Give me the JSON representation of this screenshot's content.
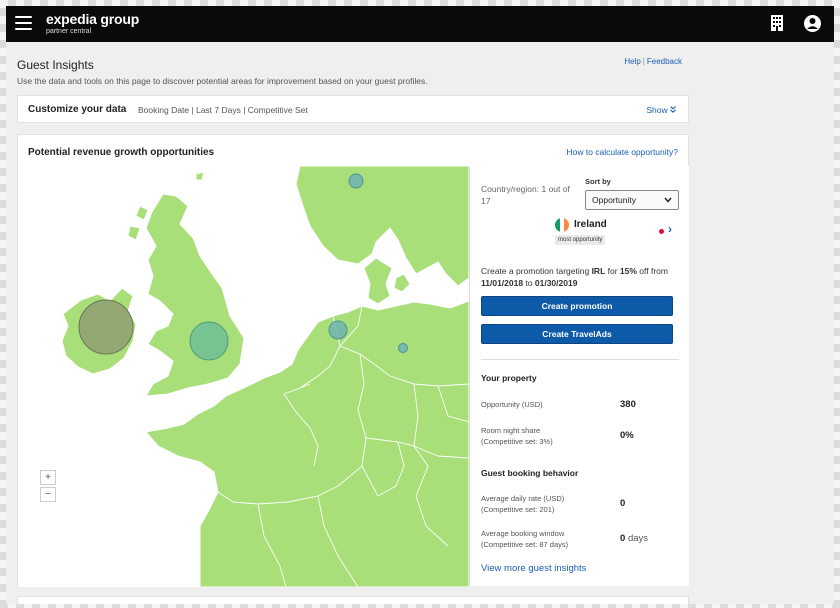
{
  "brand": {
    "name": "expedia group",
    "sub": "partner central"
  },
  "page": {
    "title": "Guest Insights",
    "description": "Use the data and tools on this page to discover potential areas for improvement based on your guest profiles.",
    "help_link": "Help",
    "feedback_link": "Feedback",
    "link_separator": "|"
  },
  "customize": {
    "label": "Customize your data",
    "filters": "Booking Date | Last 7 Days | Competitive Set",
    "show_label": "Show",
    "show_icon": "double-chevron-down-icon"
  },
  "opportunities": {
    "title": "Potential revenue growth opportunities",
    "calc_link": "How to calculate opportunity?",
    "zoom_in": "+",
    "zoom_out": "−"
  },
  "panel": {
    "country_region": "Country/region: 1 out of 17",
    "sort_label": "Sort by",
    "sort_value": "Opportunity",
    "country": "Ireland",
    "badge": "most opportunity",
    "promo_prefix": "Create a promotion targeting ",
    "promo_code": "IRL",
    "promo_mid": " for ",
    "promo_pct": "15%",
    "promo_suffix": " off from ",
    "promo_start": "11/01/2018",
    "promo_to": " to ",
    "promo_end": "01/30/2019",
    "btn_promotion": "Create promotion",
    "btn_travelads": "Create TravelAds",
    "your_property": "Your property",
    "opportunity_label": "Opportunity (USD)",
    "opportunity_value": "380",
    "room_night_label": "Room night share",
    "room_night_comp": "(Competitive set: 3%)",
    "room_night_value": "0%",
    "guest_booking": "Guest booking behavior",
    "adr_label": "Average daily rate (USD)",
    "adr_comp": "(Competitive set: 201)",
    "adr_value": "0",
    "window_label": "Average booking window",
    "window_comp": "(Competitive set: 87 days)",
    "window_value": "0",
    "window_unit": "days",
    "view_more": "View more guest insights"
  },
  "colors": {
    "land": "#a8df78",
    "border": "#ffffff",
    "ireland_bubble": "#8d9971",
    "uk_bubble": "#6fbe96",
    "small_bubble": "#6fb4b2",
    "button": "#0d5aa8",
    "link": "#1a5fb4",
    "flag_green": "#169b62",
    "flag_white": "#ffffff",
    "flag_orange": "#ff883e"
  }
}
